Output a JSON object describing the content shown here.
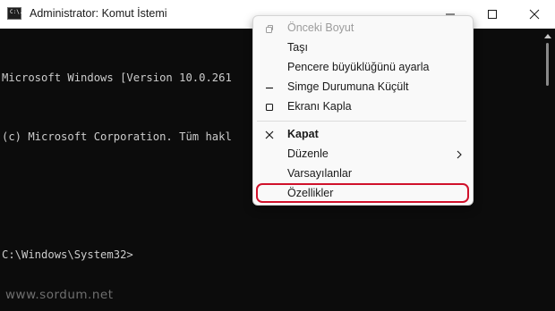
{
  "titlebar": {
    "title": "Administrator: Komut İstemi",
    "app_icon_text": "C:\\."
  },
  "console": {
    "lines": [
      "Microsoft Windows [Version 10.0.261",
      "(c) Microsoft Corporation. Tüm hakl",
      "",
      "C:\\Windows\\System32>"
    ]
  },
  "context_menu": {
    "items": [
      {
        "label": "Önceki Boyut",
        "icon": "restore-icon",
        "enabled": false
      },
      {
        "label": "Taşı",
        "icon": "",
        "enabled": true
      },
      {
        "label": "Pencere büyüklüğünü ayarla",
        "icon": "",
        "enabled": true
      },
      {
        "label": "Simge Durumuna Küçült",
        "icon": "minimize-icon",
        "enabled": true
      },
      {
        "label": "Ekranı Kapla",
        "icon": "maximize-icon",
        "enabled": true
      },
      {
        "label": "Kapat",
        "icon": "close-icon",
        "enabled": true,
        "bold": true
      },
      {
        "label": "Düzenle",
        "icon": "",
        "enabled": true,
        "submenu": true
      },
      {
        "label": "Varsayılanlar",
        "icon": "",
        "enabled": true
      },
      {
        "label": "Özellikler",
        "icon": "",
        "enabled": true,
        "highlighted": true
      }
    ]
  },
  "watermark": "www.sordum.net",
  "colors": {
    "console_bg": "#0c0c0c",
    "console_fg": "#cccccc",
    "menu_bg": "#f9f9f9",
    "highlight_border": "#d0112b"
  }
}
